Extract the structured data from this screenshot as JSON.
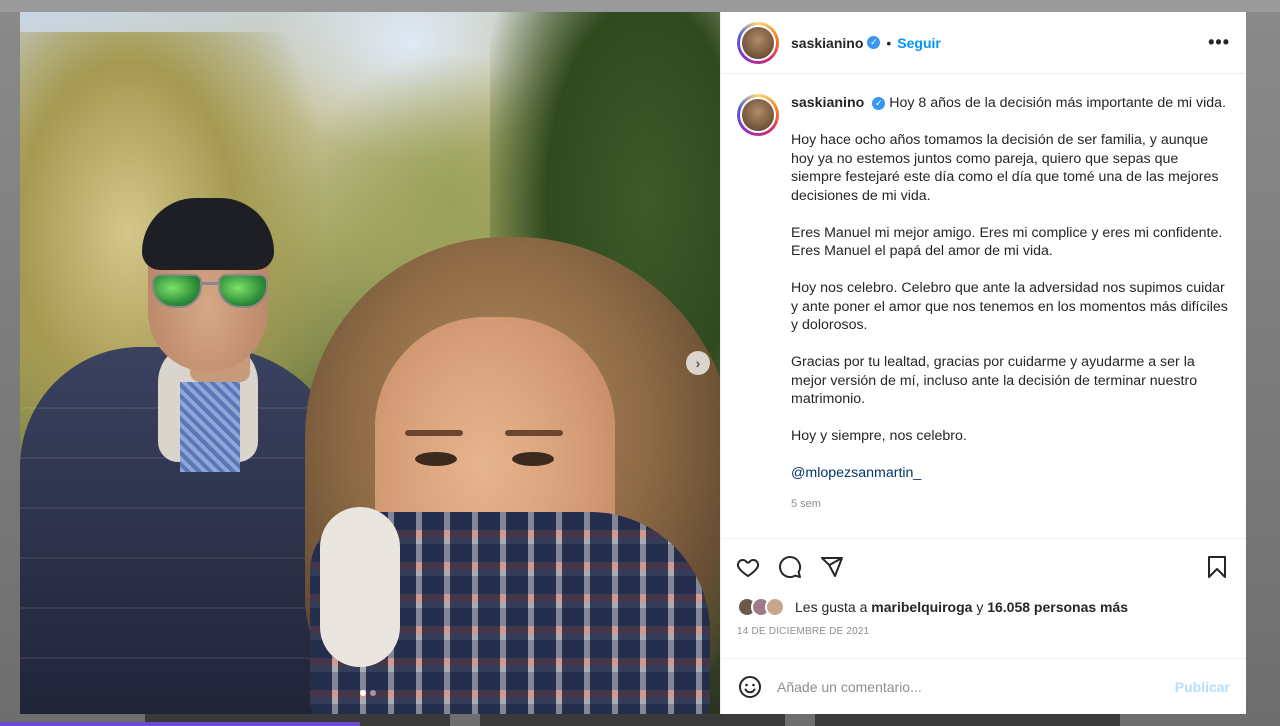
{
  "post": {
    "username": "saskianino",
    "follow_label": "Seguir",
    "dot_separator": "•",
    "more_label": "•••",
    "caption": {
      "first_line": "Hoy 8 años de la decisión más importante de mi vida.",
      "paragraphs": [
        "Hoy hace ocho años tomamos la decisión de ser familia, y aunque hoy ya no estemos juntos como pareja, quiero que sepas que siempre festejaré este día como el día que tomé una de las mejores decisiones de mi vida.",
        "Eres Manuel mi mejor amigo. Eres mi complice y eres mi confidente. Eres Manuel el papá del amor de mi vida.",
        "Hoy nos celebro. Celebro que ante la adversidad nos supimos cuidar y ante poner el amor que nos tenemos en los momentos más difíciles y dolorosos.",
        "Gracias por tu lealtad, gracias por cuidarme y ayudarme a ser la mejor versión de mí, incluso ante la decisión de terminar nuestro matrimonio.",
        "Hoy y siempre, nos celebro."
      ],
      "mention": "@mlopezsanmartin_",
      "time": "5 sem"
    },
    "likes": {
      "prefix": "Les gusta a",
      "user": "maribelquiroga",
      "connector": "y",
      "count": "16.058 personas más"
    },
    "date": "14 DE DICIEMBRE DE 2021",
    "comment": {
      "placeholder": "Añade un comentario...",
      "post_label": "Publicar"
    },
    "carousel": {
      "next_glyph": "›",
      "slides": 2,
      "active": 1
    }
  },
  "colors": {
    "follow": "#0095f6",
    "verified": "#3897f0",
    "publish_disabled": "#b2dffc"
  },
  "icons": [
    "heart-icon",
    "comment-icon",
    "share-icon",
    "bookmark-icon",
    "emoji-icon",
    "verified-icon",
    "more-icon",
    "chevron-right-icon"
  ]
}
